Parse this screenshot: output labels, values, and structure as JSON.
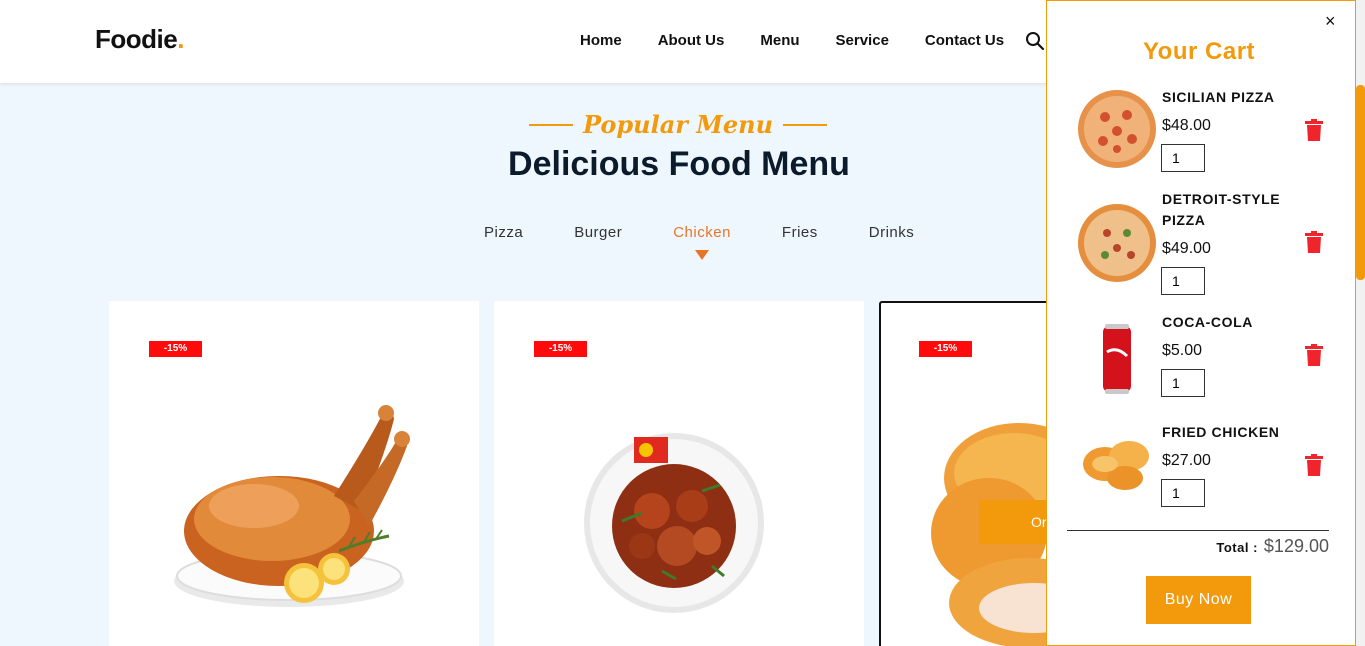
{
  "brand": {
    "name": "Foodie",
    "dot": ".",
    "accent": "#f29a0c"
  },
  "nav": {
    "items": [
      "Home",
      "About Us",
      "Menu",
      "Service",
      "Contact Us"
    ],
    "search_icon": "search-icon"
  },
  "section": {
    "subtitle": "Popular Menu",
    "title": "Delicious Food Menu"
  },
  "tabs": {
    "items": [
      "Pizza",
      "Burger",
      "Chicken",
      "Fries",
      "Drinks"
    ],
    "active": "Chicken",
    "active_color": "#e8742a"
  },
  "cards": [
    {
      "badge": "-15%"
    },
    {
      "badge": "-15%"
    },
    {
      "badge": "-15%",
      "button": "Or"
    }
  ],
  "cart": {
    "title": "Your Cart",
    "close": "×",
    "items": [
      {
        "name": "SICILIAN PIZZA",
        "price": "$48.00",
        "qty": "1",
        "icon": "pizza"
      },
      {
        "name": "DETROIT-STYLE PIZZA",
        "price": "$49.00",
        "qty": "1",
        "icon": "pizza"
      },
      {
        "name": "COCA-COLA",
        "price": "$5.00",
        "qty": "1",
        "icon": "soda-can"
      },
      {
        "name": "FRIED CHICKEN",
        "price": "$27.00",
        "qty": "1",
        "icon": "fried-chicken"
      }
    ],
    "total_label": "Total :",
    "total_value": "$129.00",
    "buy_label": "Buy Now",
    "delete_color": "#f0252c"
  }
}
